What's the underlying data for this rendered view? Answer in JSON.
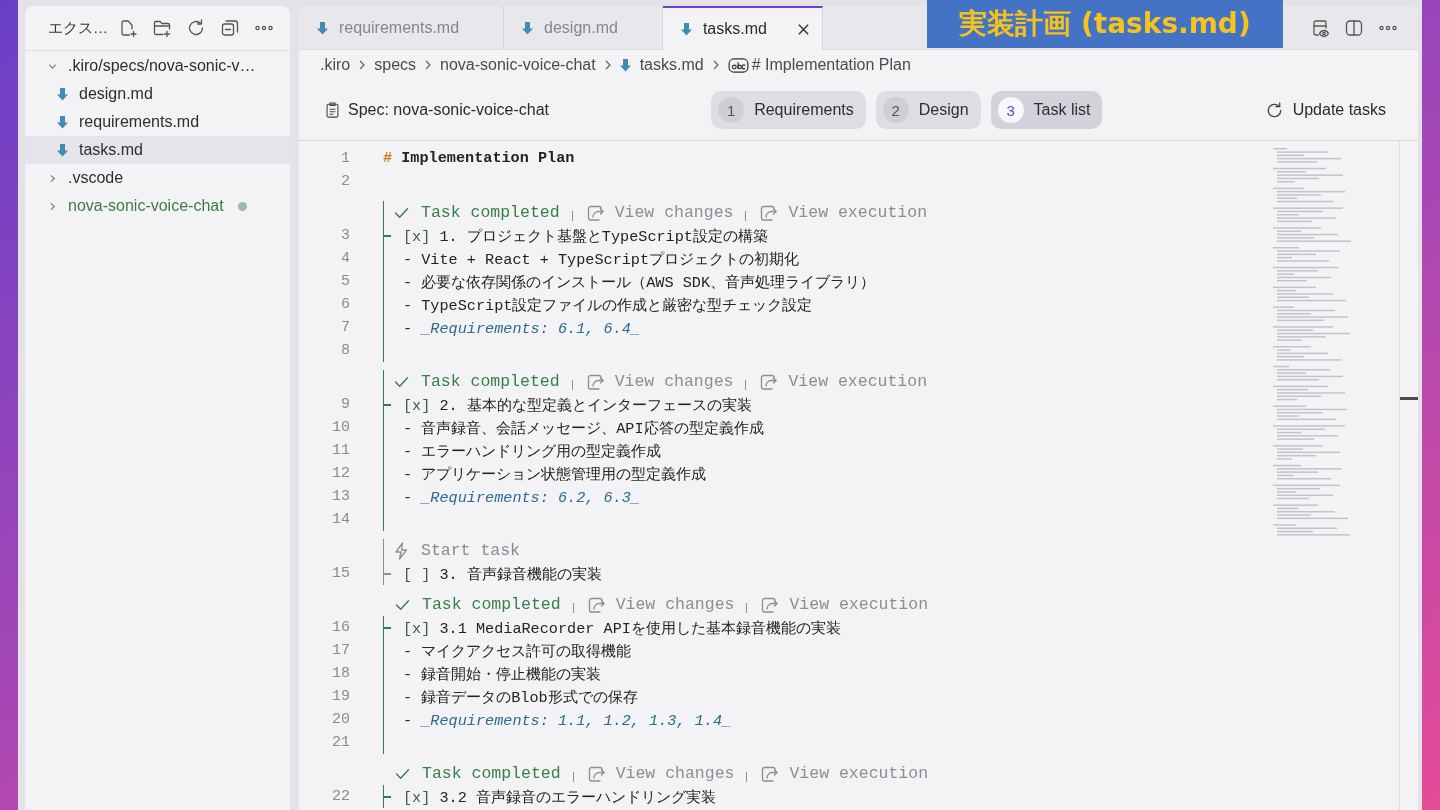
{
  "window": {
    "slide_title": "実装計画 (tasks.md)"
  },
  "explorer": {
    "title": "エクス…",
    "tree": [
      {
        "kind": "folder",
        "label": ".kiro/specs/nova-sonic-v…",
        "expanded": true,
        "selected": false,
        "changed": false,
        "children": [
          {
            "kind": "file",
            "label": "design.md",
            "selected": false
          },
          {
            "kind": "file",
            "label": "requirements.md",
            "selected": false
          },
          {
            "kind": "file",
            "label": "tasks.md",
            "selected": true
          }
        ]
      },
      {
        "kind": "folder",
        "label": ".vscode",
        "expanded": false,
        "selected": false,
        "changed": false
      },
      {
        "kind": "folder",
        "label": "nova-sonic-voice-chat",
        "expanded": false,
        "selected": false,
        "changed": true
      }
    ]
  },
  "tabs": [
    {
      "label": "requirements.md",
      "selected": false
    },
    {
      "label": "design.md",
      "selected": false
    },
    {
      "label": "tasks.md",
      "selected": true
    }
  ],
  "breadcrumb": [
    {
      "kind": "folder",
      "label": ".kiro"
    },
    {
      "kind": "folder",
      "label": "specs"
    },
    {
      "kind": "folder",
      "label": "nova-sonic-voice-chat"
    },
    {
      "kind": "file",
      "label": "tasks.md"
    },
    {
      "kind": "symbol",
      "label": "# Implementation Plan"
    }
  ],
  "spec_bar": {
    "title": "Spec: nova-sonic-voice-chat",
    "steps": [
      {
        "number": "1",
        "label": "Requirements",
        "selected": false
      },
      {
        "number": "2",
        "label": "Design",
        "selected": false
      },
      {
        "number": "3",
        "label": "Task list",
        "selected": true
      }
    ],
    "update_button": "Update tasks"
  },
  "editor": {
    "items": [
      {
        "kind": "heading",
        "number": "1",
        "marker": "#",
        "text": "Implementation Plan"
      },
      {
        "kind": "blank",
        "number": "2"
      },
      {
        "kind": "task",
        "completed": true,
        "lens": {
          "label": "Task completed",
          "actions": [
            "View changes",
            "View execution"
          ]
        },
        "lines": [
          {
            "number": "3",
            "kind": "task",
            "marker": "[x]",
            "text": "1. プロジェクト基盤とTypeScript設定の構築"
          },
          {
            "number": "4",
            "kind": "bullet",
            "marker": "-",
            "text": "Vite + React + TypeScriptプロジェクトの初期化"
          },
          {
            "number": "5",
            "kind": "bullet",
            "marker": "-",
            "text": "必要な依存関係のインストール（AWS SDK、音声処理ライブラリ）"
          },
          {
            "number": "6",
            "kind": "bullet",
            "marker": "-",
            "text": "TypeScript設定ファイルの作成と厳密な型チェック設定"
          },
          {
            "number": "7",
            "kind": "ref",
            "marker": "-",
            "text": "_Requirements: 6.1, 6.4_"
          },
          {
            "number": "8",
            "kind": "blank"
          }
        ]
      },
      {
        "kind": "task",
        "completed": true,
        "lens": {
          "label": "Task completed",
          "actions": [
            "View changes",
            "View execution"
          ]
        },
        "lines": [
          {
            "number": "9",
            "kind": "task",
            "marker": "[x]",
            "text": "2. 基本的な型定義とインターフェースの実装"
          },
          {
            "number": "10",
            "kind": "bullet",
            "marker": "-",
            "text": "音声録音、会話メッセージ、API応答の型定義作成"
          },
          {
            "number": "11",
            "kind": "bullet",
            "marker": "-",
            "text": "エラーハンドリング用の型定義作成"
          },
          {
            "number": "12",
            "kind": "bullet",
            "marker": "-",
            "text": "アプリケーション状態管理用の型定義作成"
          },
          {
            "number": "13",
            "kind": "ref",
            "marker": "-",
            "text": "_Requirements: 6.2, 6.3_"
          },
          {
            "number": "14",
            "kind": "blank"
          }
        ]
      },
      {
        "kind": "task",
        "completed": false,
        "lens": {
          "label": "Start task"
        },
        "lines": [
          {
            "number": "15",
            "kind": "task",
            "marker": "[ ]",
            "text": "3. 音声録音機能の実装"
          }
        ],
        "children": [
          {
            "completed": true,
            "lens": {
              "label": "Task completed",
              "actions": [
                "View changes",
                "View execution"
              ]
            },
            "lines": [
              {
                "number": "16",
                "kind": "task",
                "marker": "[x]",
                "text": "3.1 MediaRecorder APIを使用した基本録音機能の実装"
              },
              {
                "number": "17",
                "kind": "bullet",
                "marker": "-",
                "text": "マイクアクセス許可の取得機能"
              },
              {
                "number": "18",
                "kind": "bullet",
                "marker": "-",
                "text": "録音開始・停止機能の実装"
              },
              {
                "number": "19",
                "kind": "bullet",
                "marker": "-",
                "text": "録音データのBlob形式での保存"
              },
              {
                "number": "20",
                "kind": "ref",
                "marker": "-",
                "text": "_Requirements: 1.1, 1.2, 1.3, 1.4_"
              },
              {
                "number": "21",
                "kind": "blank"
              }
            ]
          },
          {
            "completed": true,
            "lens": {
              "label": "Task completed",
              "actions": [
                "View changes",
                "View execution"
              ]
            },
            "lines": [
              {
                "number": "22",
                "kind": "task",
                "marker": "[x]",
                "text": "3.2 音声録音のエラーハンドリング実装"
              }
            ]
          }
        ]
      }
    ]
  }
}
